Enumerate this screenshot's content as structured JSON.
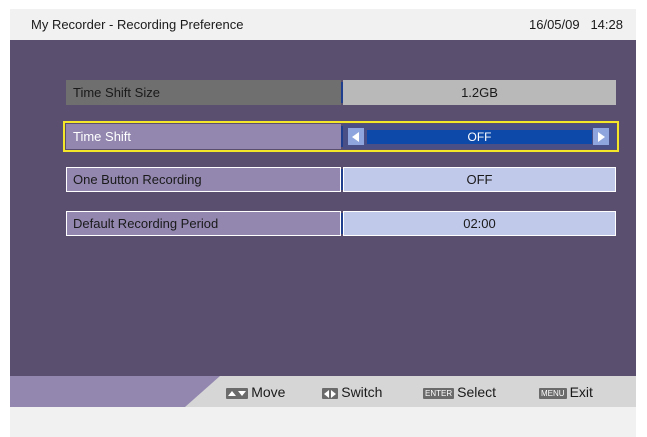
{
  "header": {
    "title": "My Recorder - Recording Preference",
    "date": "16/05/09",
    "time": "14:28"
  },
  "settings": [
    {
      "label": "Time Shift Size",
      "value": "1.2GB",
      "state": "disabled"
    },
    {
      "label": "Time Shift",
      "value": "OFF",
      "state": "focused"
    },
    {
      "label": "One Button Recording",
      "value": "OFF",
      "state": "normal"
    },
    {
      "label": "Default Recording Period",
      "value": "02:00",
      "state": "normal"
    }
  ],
  "footer": {
    "move": {
      "key": "up-down-arrows-icon",
      "label": "Move"
    },
    "switch": {
      "key": "left-right-arrows-icon",
      "label": "Switch"
    },
    "select": {
      "key": "ENTER",
      "label": "Select"
    },
    "exit": {
      "key": "MENU",
      "label": "Exit"
    }
  },
  "colors": {
    "panel": "#5a4f6e",
    "focus_outline": "#f4e628",
    "value_highlight": "#0d49a8",
    "label_bg": "#9387b0",
    "value_bg": "#c1c9ea"
  }
}
